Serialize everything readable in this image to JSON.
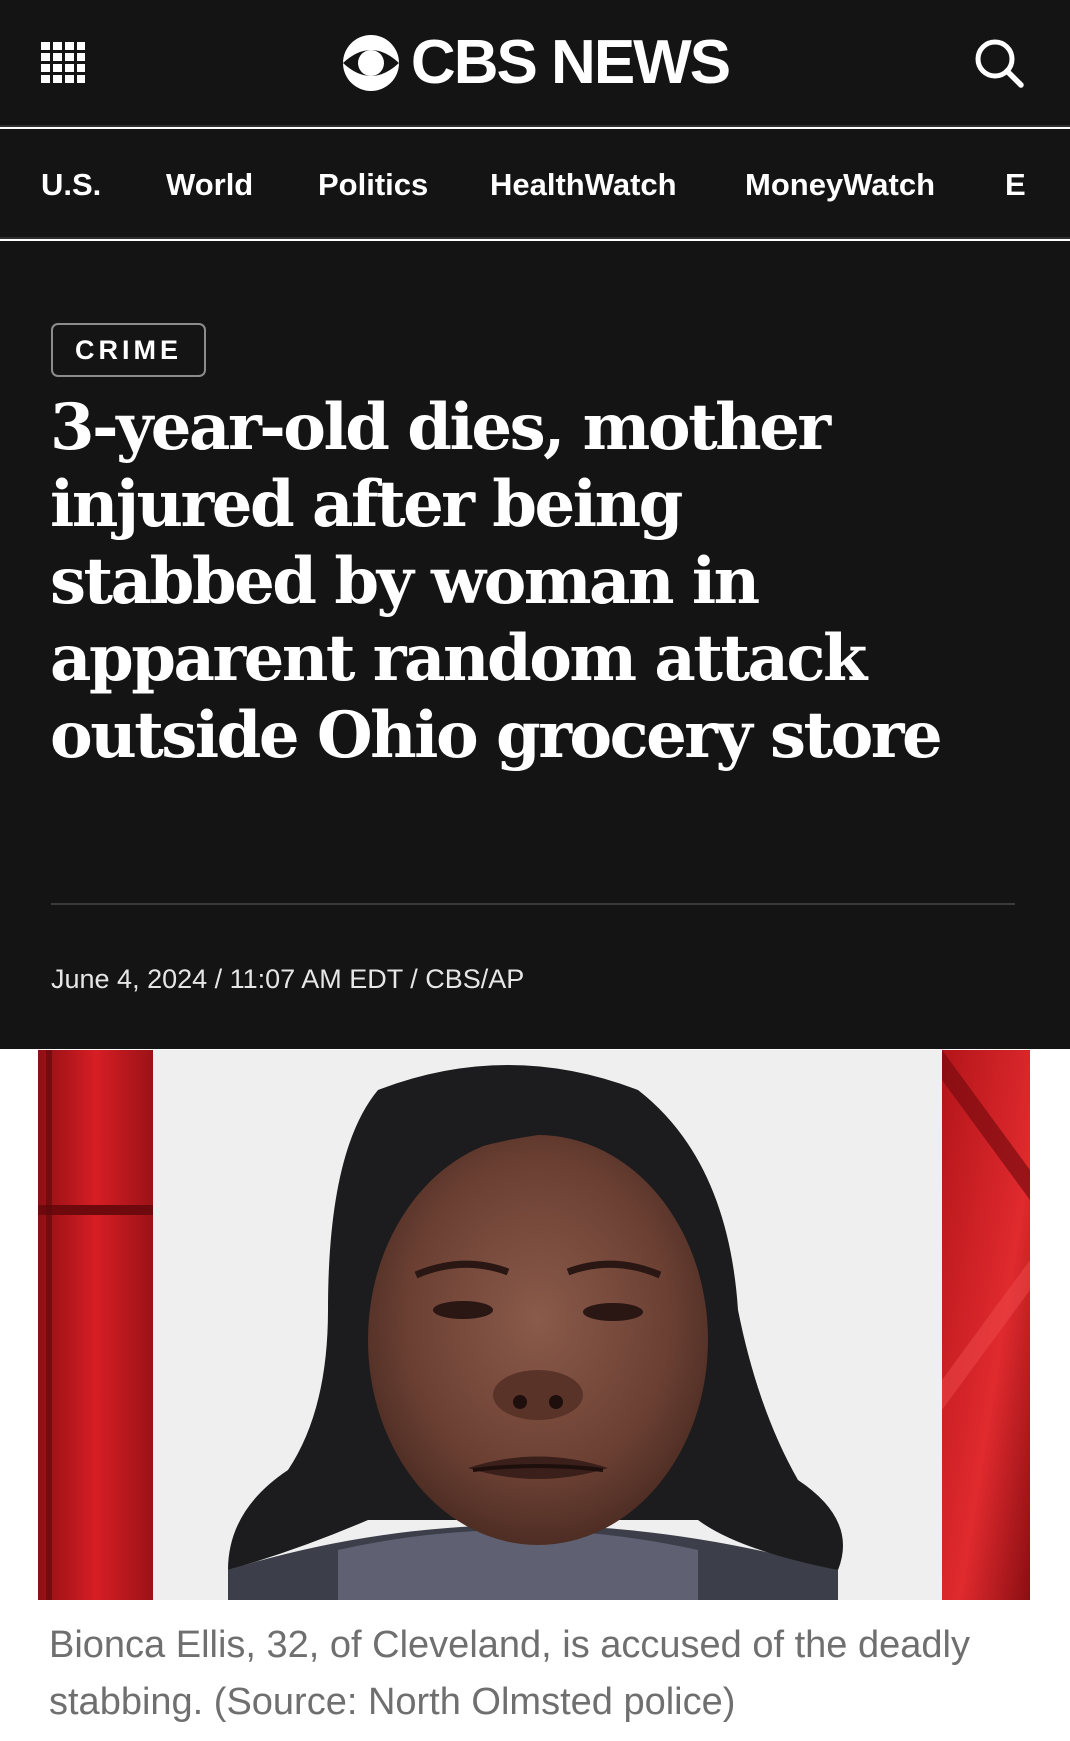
{
  "header": {
    "brand": "CBS NEWS",
    "menu_icon": "grid-menu-icon",
    "search_icon": "search-icon"
  },
  "nav": {
    "items": [
      "U.S.",
      "World",
      "Politics",
      "HealthWatch",
      "MoneyWatch",
      "E"
    ]
  },
  "article": {
    "category": "CRIME",
    "headline": "3-year-old dies, mother injured after being stabbed by woman in apparent random attack outside Ohio grocery store",
    "dateline": "June 4, 2024 / 11:07 AM EDT / CBS/AP",
    "caption": "Bionca Ellis, 32, of Cleveland, is accused of the deadly stabbing.   (Source: North Olmsted police)"
  },
  "colors": {
    "background_dark": "#141414",
    "text_light": "#ffffff",
    "caption_gray": "#6f6f6f",
    "frame_red": "#cc1a1f"
  }
}
